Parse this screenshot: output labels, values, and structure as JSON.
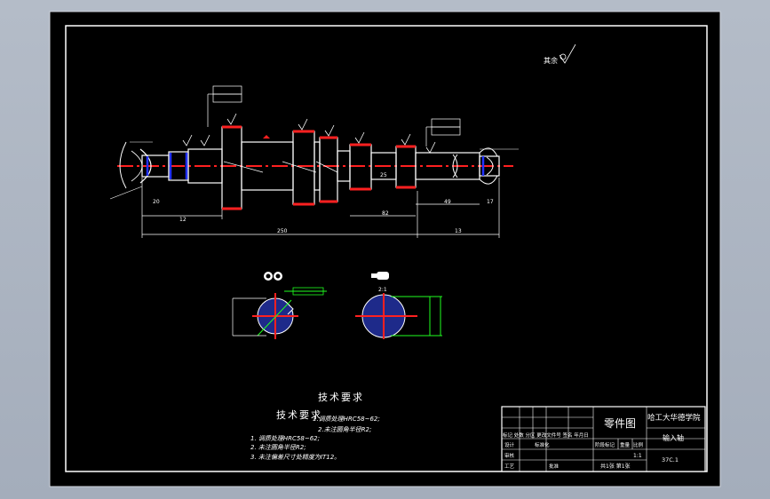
{
  "drawing": {
    "roughness_label": "其余",
    "tech_title_1": "技术要求",
    "tech_title_2": "技术要求",
    "tech_req_overlay": [
      "1.调质处理HRC58~62;",
      "2.未注圆角半径R2;"
    ],
    "tech_req": [
      "1. 调质处理HRC58~62;",
      "2. 未注圆角半径R2;",
      "3. 未注偏差尺寸处精度为IT12。"
    ],
    "section_b_label": "2:1"
  },
  "dimensions": {
    "d12": "12",
    "d250": "250",
    "d13": "13",
    "d82": "82",
    "d49": "49",
    "d17": "17",
    "d25": "25",
    "d20": "20"
  },
  "title_block": {
    "drawing_type": "零件图",
    "school": "哈工大华德学院",
    "part_name": "输入轴",
    "scale_label": "比例",
    "scale_value": "1:1",
    "mass_label": "重量",
    "stage_label": "阶段标记",
    "sheet_info": "共1张 第1张",
    "material": "37C.1",
    "rev_header": "标记 处数 分区 更改文件号 签名 年月日",
    "designer_label": "设计",
    "checker_label": "审核",
    "std_label": "标准化",
    "process_label": "工艺",
    "approve_label": "批准"
  },
  "colors": {
    "background": "#000000",
    "frame": "#ffffff",
    "centerline": "#ff2020",
    "hidden": "#2030ff",
    "leader": "#20ff20",
    "accent": "#e04080"
  }
}
